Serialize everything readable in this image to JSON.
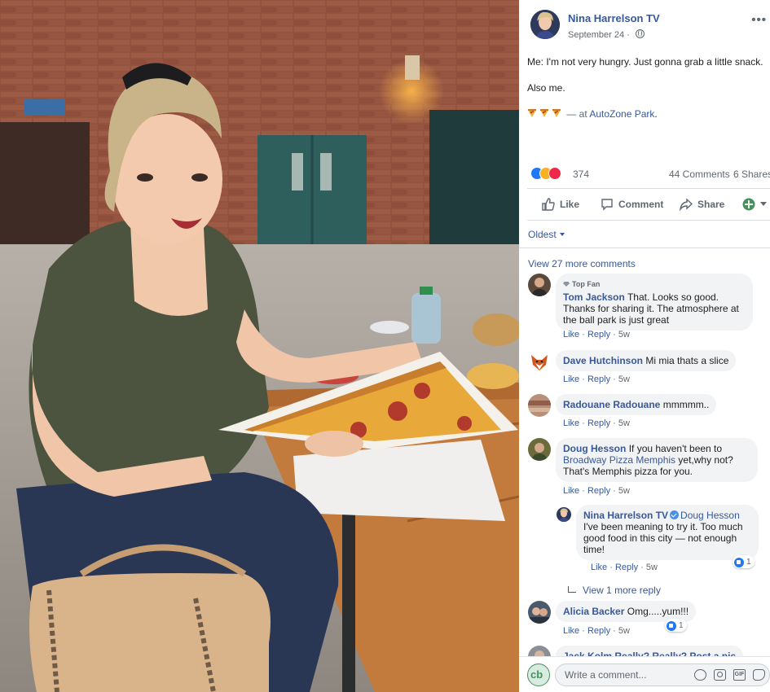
{
  "post": {
    "page_name": "Nina Harrelson TV",
    "date": "September 24 · ",
    "more_label": "•••",
    "text_line1": "Me: I'm not very hungry. Just gonna grab a little snack.",
    "text_line2": "Also me.",
    "location_prefix": " — at ",
    "location": "AutoZone Park",
    "location_suffix": "."
  },
  "stats": {
    "reaction_count": "374",
    "comments": "44 Comments",
    "shares": "6 Shares"
  },
  "actions": {
    "like": "Like",
    "comment": "Comment",
    "share": "Share"
  },
  "comments_section": {
    "sort_label": "Oldest",
    "view_more": "View 27 more comments",
    "view_more_reply": "View 1 more reply",
    "like_label": "Like",
    "reply_label": "Reply",
    "separator": " · "
  },
  "comments": [
    {
      "badge": "Top Fan",
      "name": "Tom Jackson",
      "text": "That. Looks so good. Thanks for sharing it. The atmosphere at the ball park is just great",
      "time": "5w"
    },
    {
      "name": "Dave Hutchinson",
      "text": "Mi mia thats a slice",
      "time": "5w"
    },
    {
      "name": "Radouane Radouane",
      "text": "mmmmm..",
      "time": "5w"
    },
    {
      "name": "Doug Hesson",
      "text_before": "If you haven't been to ",
      "link": "Broadway Pizza Memphis",
      "text_after": " yet,why not? That's Memphis pizza for you.",
      "time": "5w"
    },
    {
      "name": "Nina Harrelson TV",
      "mention": "Doug Hesson",
      "text": "I've been meaning to try it. Too much good food in this city — not enough time!",
      "time": "5w",
      "reactions": "1"
    },
    {
      "name": "Alicia Backer",
      "text": "Omg.....yum!!!",
      "time": "5w",
      "reactions": "1"
    },
    {
      "partial": "Jack Kolm  Really? Really? Post a pic"
    }
  ],
  "composer": {
    "placeholder": "Write a comment...",
    "avatar_initials": "cb",
    "gif_label": "GIF"
  },
  "colors": {
    "link": "#385898",
    "like_blue": "#2078f4",
    "bubble_bg": "#f2f3f5",
    "meta_gray": "#606770"
  },
  "icons": [
    "globe-icon",
    "more-icon",
    "like-icon",
    "comment-icon",
    "share-icon",
    "emoji-icon",
    "camera-icon",
    "gif-icon",
    "sticker-icon",
    "verified-icon",
    "top-fan-icon",
    "pizza-emoji"
  ]
}
